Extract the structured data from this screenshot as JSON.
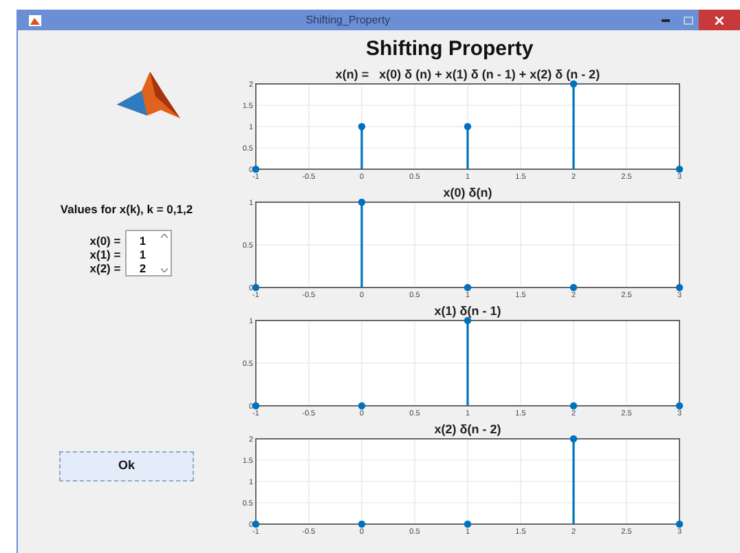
{
  "window": {
    "title": "Shifting_Property"
  },
  "heading": "Shifting Property",
  "values_panel": {
    "label": "Values for x(k), k = 0,1,2",
    "items": [
      {
        "name": "x(0) =",
        "value": "1",
        "selected": false
      },
      {
        "name": "x(1) =",
        "value": "1",
        "selected": false
      },
      {
        "name": "x(2) =",
        "value": "2",
        "selected": false
      }
    ]
  },
  "ok_button": "Ok",
  "plots": [
    {
      "chart_data": {
        "type": "bar",
        "title": "x(n) =   x(0) δ (n) + x(1) δ (n - 1) + x(2) δ (n - 2)",
        "x": [
          -1,
          0,
          1,
          2,
          3
        ],
        "grid": true,
        "series": [
          {
            "color": "#0072bd",
            "values": [
              0,
              1,
              1,
              2,
              0
            ]
          }
        ],
        "xlim": [
          -1,
          3
        ],
        "ylim": [
          0,
          2
        ],
        "xticks": [
          -1,
          -0.5,
          0,
          0.5,
          1,
          1.5,
          2,
          2.5,
          3
        ],
        "yticks": [
          0,
          0.5,
          1,
          1.5,
          2
        ]
      }
    },
    {
      "chart_data": {
        "type": "bar",
        "title": "x(0) δ(n)",
        "x": [
          -1,
          0,
          1,
          2,
          3
        ],
        "grid": true,
        "series": [
          {
            "color": "#0072bd",
            "values": [
              0,
              1,
              0,
              0,
              0
            ]
          }
        ],
        "xlim": [
          -1,
          3
        ],
        "ylim": [
          0,
          1
        ],
        "xticks": [
          -1,
          -0.5,
          0,
          0.5,
          1,
          1.5,
          2,
          2.5,
          3
        ],
        "yticks": [
          0,
          0.5,
          1
        ]
      }
    },
    {
      "chart_data": {
        "type": "bar",
        "title": "x(1) δ(n - 1)",
        "x": [
          -1,
          0,
          1,
          2,
          3
        ],
        "grid": true,
        "series": [
          {
            "color": "#0072bd",
            "values": [
              0,
              0,
              1,
              0,
              0
            ]
          }
        ],
        "xlim": [
          -1,
          3
        ],
        "ylim": [
          0,
          1
        ],
        "xticks": [
          -1,
          -0.5,
          0,
          0.5,
          1,
          1.5,
          2,
          2.5,
          3
        ],
        "yticks": [
          0,
          0.5,
          1
        ]
      }
    },
    {
      "chart_data": {
        "type": "bar",
        "title": "x(2) δ(n - 2)",
        "x": [
          -1,
          0,
          1,
          2,
          3
        ],
        "grid": true,
        "series": [
          {
            "color": "#0072bd",
            "values": [
              0,
              0,
              0,
              2,
              0
            ]
          }
        ],
        "xlim": [
          -1,
          3
        ],
        "ylim": [
          0,
          2
        ],
        "xticks": [
          -1,
          -0.5,
          0,
          0.5,
          1,
          1.5,
          2,
          2.5,
          3
        ],
        "yticks": [
          0,
          0.5,
          1,
          1.5,
          2
        ]
      }
    }
  ]
}
